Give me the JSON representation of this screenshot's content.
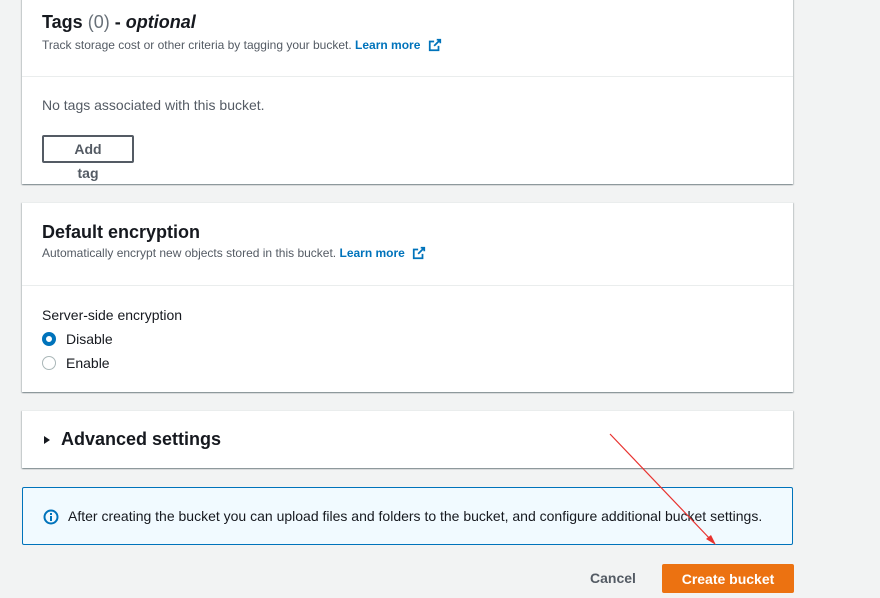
{
  "tags_panel": {
    "title": "Tags",
    "count": "(0)",
    "dash": "-",
    "optional": "optional",
    "description": "Track storage cost or other criteria by tagging your bucket.",
    "learn_more": "Learn more",
    "empty_text": "No tags associated with this bucket.",
    "add_tag_label": "Add tag"
  },
  "encryption_panel": {
    "title": "Default encryption",
    "description": "Automatically encrypt new objects stored in this bucket.",
    "learn_more": "Learn more",
    "field_label": "Server-side encryption",
    "options": [
      {
        "label": "Disable",
        "selected": true
      },
      {
        "label": "Enable",
        "selected": false
      }
    ]
  },
  "advanced_panel": {
    "title": "Advanced settings",
    "expanded": false
  },
  "info_alert": {
    "icon": "info-icon",
    "text": "After creating the bucket you can upload files and folders to the bucket, and configure additional bucket settings."
  },
  "footer": {
    "cancel_label": "Cancel",
    "create_label": "Create bucket"
  },
  "colors": {
    "primary": "#ec7211",
    "link": "#0073bb",
    "info_bg": "#f1faff",
    "annotation_arrow": "#e8322f"
  }
}
